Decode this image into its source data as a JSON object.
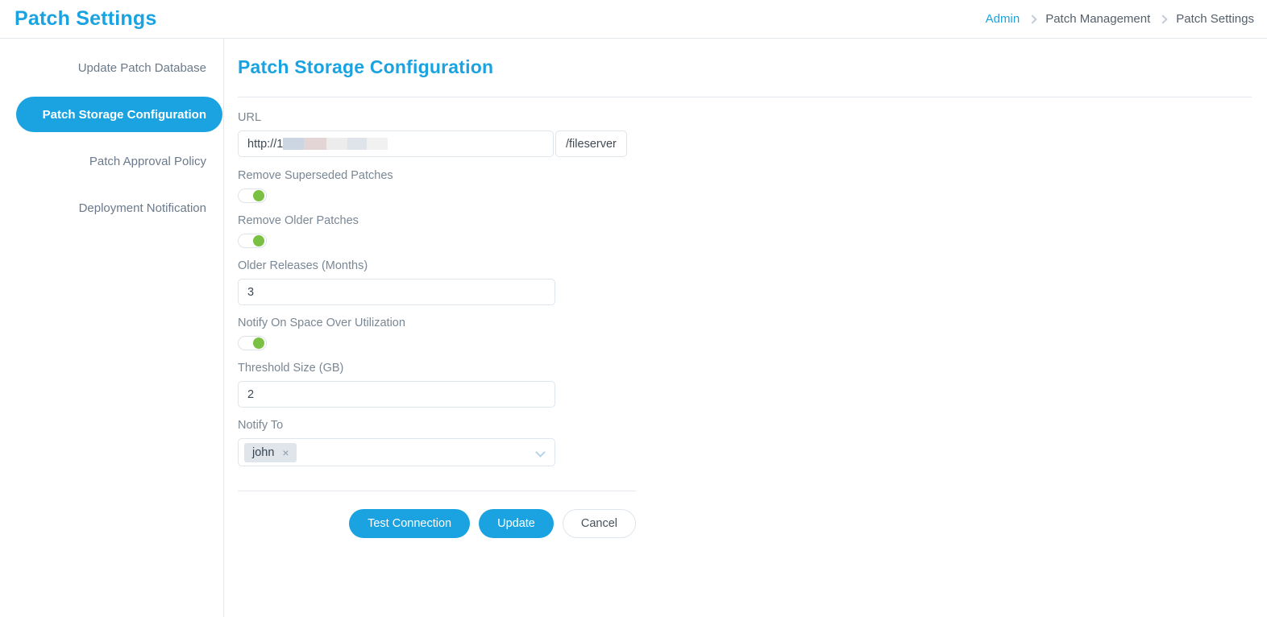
{
  "header": {
    "title": "Patch Settings",
    "breadcrumb": [
      {
        "label": "Admin",
        "link": true
      },
      {
        "label": "Patch Management",
        "link": false
      },
      {
        "label": "Patch Settings",
        "link": false
      }
    ]
  },
  "sidebar": {
    "items": [
      {
        "label": "Update Patch Database",
        "active": false
      },
      {
        "label": "Patch Storage Configuration",
        "active": true
      },
      {
        "label": "Patch Approval Policy",
        "active": false
      },
      {
        "label": "Deployment Notification",
        "active": false
      }
    ]
  },
  "main": {
    "section_title": "Patch Storage Configuration",
    "url": {
      "label": "URL",
      "value": "http://1",
      "redacted": true,
      "suffix": "/fileserver"
    },
    "remove_superseded": {
      "label": "Remove Superseded Patches",
      "on": true
    },
    "remove_older": {
      "label": "Remove Older Patches",
      "on": true
    },
    "older_releases": {
      "label": "Older Releases (Months)",
      "value": "3"
    },
    "notify_space": {
      "label": "Notify On Space Over Utilization",
      "on": true
    },
    "threshold_size": {
      "label": "Threshold Size (GB)",
      "value": "2"
    },
    "notify_to": {
      "label": "Notify To",
      "chips": [
        {
          "label": "john",
          "remove": "×"
        }
      ],
      "chevron": "chevron-down"
    },
    "buttons": {
      "test_connection": "Test Connection",
      "update": "Update",
      "cancel": "Cancel"
    }
  },
  "colors": {
    "accent": "#1aa3e0",
    "toggle_on": "#7ac143",
    "label": "#7a8794",
    "border": "#dfe5ec"
  }
}
